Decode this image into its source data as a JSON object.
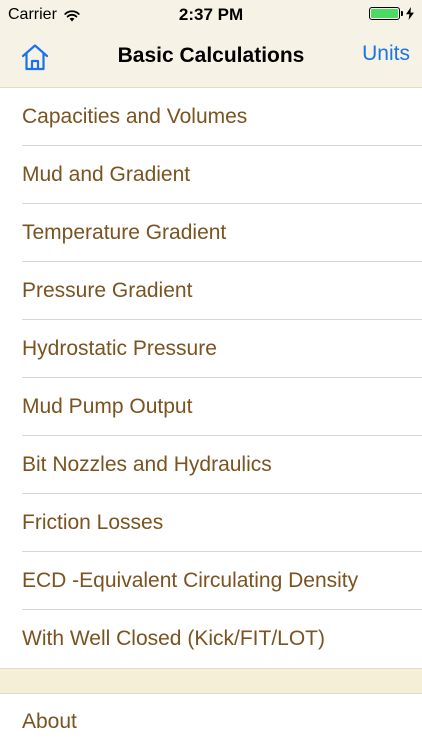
{
  "status_bar": {
    "carrier": "Carrier",
    "time": "2:37 PM",
    "battery_level": 1.0,
    "battery_color": "#4cd964",
    "charging": true
  },
  "nav_bar": {
    "title": "Basic Calculations",
    "right_button": "Units",
    "left_icon": "home-icon",
    "accent_color": "#1a73e8"
  },
  "menu": {
    "text_color": "#7a5320",
    "items": [
      {
        "label": "Capacities and Volumes"
      },
      {
        "label": "Mud and Gradient"
      },
      {
        "label": "Temperature Gradient"
      },
      {
        "label": "Pressure Gradient"
      },
      {
        "label": "Hydrostatic Pressure"
      },
      {
        "label": "Mud Pump Output"
      },
      {
        "label": "Bit Nozzles and Hydraulics"
      },
      {
        "label": "Friction Losses"
      },
      {
        "label": "ECD -Equivalent Circulating Density"
      },
      {
        "label": "With Well Closed (Kick/FIT/LOT)"
      }
    ]
  },
  "footer": {
    "about_label": "About"
  }
}
